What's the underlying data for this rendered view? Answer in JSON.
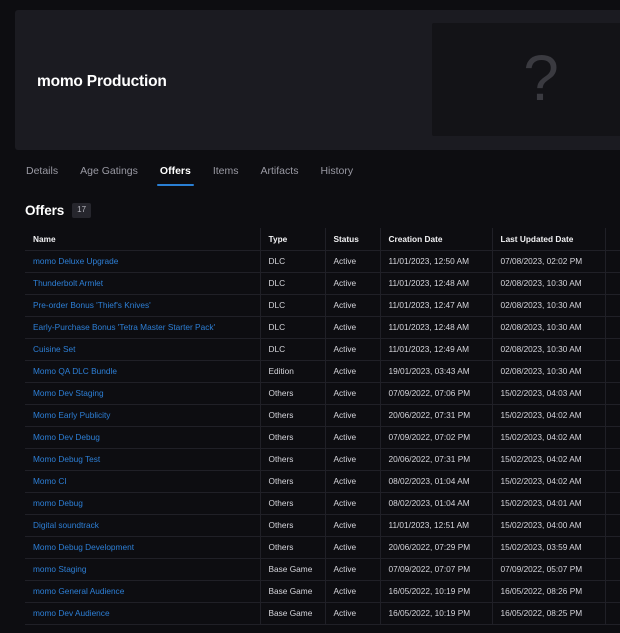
{
  "hero": {
    "title": "momo Production",
    "thumbnail_placeholder_glyph": "?"
  },
  "tabs": [
    {
      "label": "Details",
      "active": false
    },
    {
      "label": "Age Gatings",
      "active": false
    },
    {
      "label": "Offers",
      "active": true
    },
    {
      "label": "Items",
      "active": false
    },
    {
      "label": "Artifacts",
      "active": false
    },
    {
      "label": "History",
      "active": false
    }
  ],
  "section": {
    "title": "Offers",
    "count_badge": "17"
  },
  "table": {
    "columns": [
      "Name",
      "Type",
      "Status",
      "Creation Date",
      "Last Updated Date"
    ],
    "rows": [
      {
        "name": "momo Deluxe Upgrade",
        "type": "DLC",
        "status": "Active",
        "created": "11/01/2023, 12:50 AM",
        "updated": "07/08/2023, 02:02 PM"
      },
      {
        "name": "Thunderbolt Armlet",
        "type": "DLC",
        "status": "Active",
        "created": "11/01/2023, 12:48 AM",
        "updated": "02/08/2023, 10:30 AM"
      },
      {
        "name": "Pre-order Bonus 'Thief's Knives'",
        "type": "DLC",
        "status": "Active",
        "created": "11/01/2023, 12:47 AM",
        "updated": "02/08/2023, 10:30 AM"
      },
      {
        "name": "Early-Purchase Bonus 'Tetra Master Starter Pack'",
        "type": "DLC",
        "status": "Active",
        "created": "11/01/2023, 12:48 AM",
        "updated": "02/08/2023, 10:30 AM"
      },
      {
        "name": "Cuisine Set",
        "type": "DLC",
        "status": "Active",
        "created": "11/01/2023, 12:49 AM",
        "updated": "02/08/2023, 10:30 AM"
      },
      {
        "name": "Momo QA DLC Bundle",
        "type": "Edition",
        "status": "Active",
        "created": "19/01/2023, 03:43 AM",
        "updated": "02/08/2023, 10:30 AM"
      },
      {
        "name": "Momo Dev Staging",
        "type": "Others",
        "status": "Active",
        "created": "07/09/2022, 07:06 PM",
        "updated": "15/02/2023, 04:03 AM"
      },
      {
        "name": "Momo Early Publicity",
        "type": "Others",
        "status": "Active",
        "created": "20/06/2022, 07:31 PM",
        "updated": "15/02/2023, 04:02 AM"
      },
      {
        "name": "Momo Dev Debug",
        "type": "Others",
        "status": "Active",
        "created": "07/09/2022, 07:02 PM",
        "updated": "15/02/2023, 04:02 AM"
      },
      {
        "name": "Momo Debug Test",
        "type": "Others",
        "status": "Active",
        "created": "20/06/2022, 07:31 PM",
        "updated": "15/02/2023, 04:02 AM"
      },
      {
        "name": "Momo CI",
        "type": "Others",
        "status": "Active",
        "created": "08/02/2023, 01:04 AM",
        "updated": "15/02/2023, 04:02 AM"
      },
      {
        "name": "momo Debug",
        "type": "Others",
        "status": "Active",
        "created": "08/02/2023, 01:04 AM",
        "updated": "15/02/2023, 04:01 AM"
      },
      {
        "name": "Digital soundtrack",
        "type": "Others",
        "status": "Active",
        "created": "11/01/2023, 12:51 AM",
        "updated": "15/02/2023, 04:00 AM"
      },
      {
        "name": "Momo Debug Development",
        "type": "Others",
        "status": "Active",
        "created": "20/06/2022, 07:29 PM",
        "updated": "15/02/2023, 03:59 AM"
      },
      {
        "name": "momo Staging",
        "type": "Base Game",
        "status": "Active",
        "created": "07/09/2022, 07:07 PM",
        "updated": "07/09/2022, 05:07 PM"
      },
      {
        "name": "momo General Audience",
        "type": "Base Game",
        "status": "Active",
        "created": "16/05/2022, 10:19 PM",
        "updated": "16/05/2022, 08:26 PM"
      },
      {
        "name": "momo Dev Audience",
        "type": "Base Game",
        "status": "Active",
        "created": "16/05/2022, 10:19 PM",
        "updated": "16/05/2022, 08:25 PM"
      }
    ]
  },
  "colors": {
    "page_background": "#0d0d11",
    "card_background": "#1b1b21",
    "link": "#2d7fd6",
    "accent_tab_underline": "#2a7fd4",
    "border": "#202027"
  }
}
